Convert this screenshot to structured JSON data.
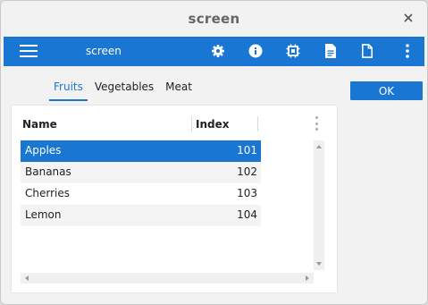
{
  "window": {
    "title": "screen"
  },
  "appbar": {
    "title": "screen",
    "icons": [
      "settings-icon",
      "info-icon",
      "chip-icon",
      "document-icon",
      "file-icon",
      "more-vert-icon"
    ]
  },
  "tabs": [
    {
      "label": "Fruits",
      "active": true
    },
    {
      "label": "Vegetables",
      "active": false
    },
    {
      "label": "Meat",
      "active": false
    }
  ],
  "ok_button": {
    "label": "OK"
  },
  "table": {
    "columns": [
      "Name",
      "Index"
    ],
    "rows": [
      {
        "name": "Apples",
        "index": "101",
        "selected": true
      },
      {
        "name": "Bananas",
        "index": "102",
        "selected": false
      },
      {
        "name": "Cherries",
        "index": "103",
        "selected": false
      },
      {
        "name": "Lemon",
        "index": "104",
        "selected": false
      }
    ]
  },
  "colors": {
    "accent": "#1976d2",
    "selected_row": "#1976d2",
    "alt_row": "#f4f4f4"
  }
}
